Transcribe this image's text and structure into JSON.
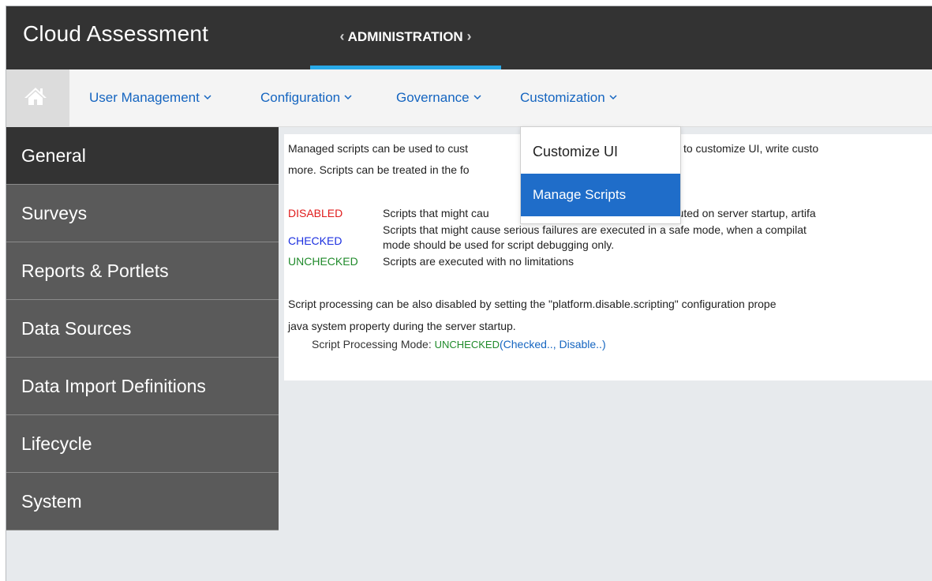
{
  "header": {
    "app_title": "Cloud Assessment",
    "active_tab": "ADMINISTRATION",
    "prev_glyph": "‹",
    "next_glyph": "›"
  },
  "nav": {
    "home_icon": "home-icon",
    "items": [
      {
        "label": "User Management"
      },
      {
        "label": "Configuration"
      },
      {
        "label": "Governance"
      },
      {
        "label": "Customization"
      }
    ],
    "caret": "⌵"
  },
  "sidebar": {
    "items": [
      {
        "label": "General"
      },
      {
        "label": "Surveys"
      },
      {
        "label": "Reports & Portlets"
      },
      {
        "label": "Data Sources"
      },
      {
        "label": "Data Import Definitions"
      },
      {
        "label": "Lifecycle"
      },
      {
        "label": "System"
      }
    ]
  },
  "content": {
    "intro_line1_a": "Managed scripts can be used to cust",
    "intro_line1_b": "an use them to customize UI, write custo",
    "intro_line2": "more. Scripts can be treated in the fo",
    "modes": [
      {
        "label": "DISABLED",
        "desc": "Scripts that might cau",
        "desc_b": "cripts executed on server startup, artifa"
      },
      {
        "label": "CHECKED",
        "desc": "Scripts that might cause serious failures are executed in a safe mode, when a compilat",
        "desc2": "mode should be used for script debugging only."
      },
      {
        "label": "UNCHECKED",
        "desc": "Scripts are executed with no limitations"
      }
    ],
    "note_line1": "Script processing can be also disabled by setting the \"platform.disable.scripting\" configuration prope",
    "note_line2": "java system property during the server startup.",
    "mode_label": "Script Processing Mode:",
    "mode_value": "UNCHECKED",
    "mode_links_open": "(",
    "mode_link_checked": "Checked..",
    "mode_link_sep": ", ",
    "mode_link_disable": "Disable..",
    "mode_links_close": ")"
  },
  "dropdown": {
    "items": [
      {
        "label": "Customize UI"
      },
      {
        "label": "Manage Scripts"
      }
    ]
  },
  "colors": {
    "topbar": "#333333",
    "accent": "#29a9e8",
    "link": "#1565c0",
    "selected": "#1f6dc9",
    "disabled": "#e01b1b",
    "checked": "#1b2fe0",
    "unchecked": "#1f8a2a"
  }
}
